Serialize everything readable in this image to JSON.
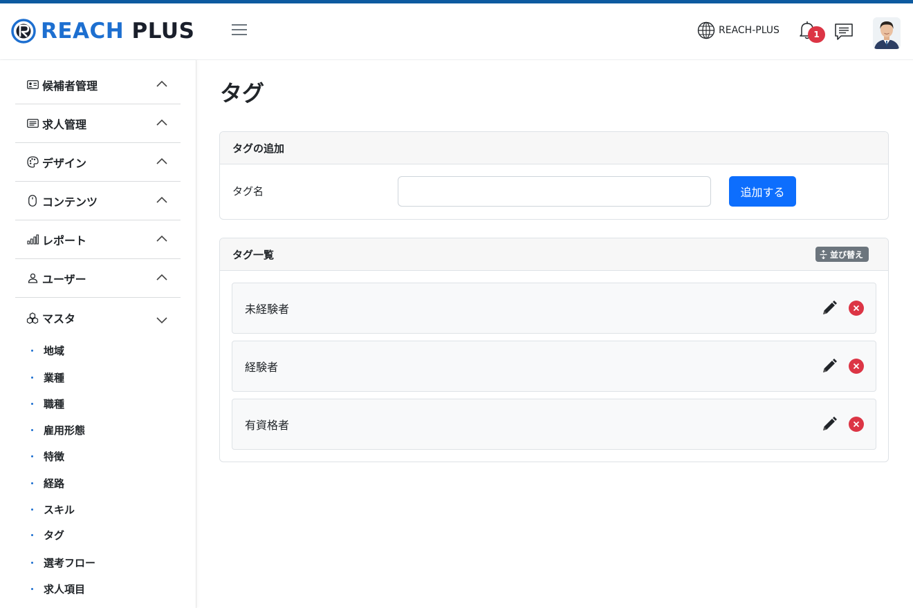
{
  "header": {
    "brand_part1": "REACH",
    "brand_part2": "PLUS",
    "org_name": "REACH-PLUS",
    "notification_count": "1",
    "brand_color": "#1d6fd0",
    "icons": [
      "logo-mark-icon",
      "hamburger-icon",
      "globe-icon",
      "bell-icon",
      "chat-icon"
    ]
  },
  "sidebar": {
    "groups": [
      {
        "label": "候補者管理",
        "icon": "id-card-icon",
        "expanded": false
      },
      {
        "label": "求人管理",
        "icon": "list-icon",
        "expanded": false
      },
      {
        "label": "デザイン",
        "icon": "palette-icon",
        "expanded": false
      },
      {
        "label": "コンテンツ",
        "icon": "mouse-icon",
        "expanded": false
      },
      {
        "label": "レポート",
        "icon": "bar-chart-icon",
        "expanded": false
      },
      {
        "label": "ユーザー",
        "icon": "person-icon",
        "expanded": false
      },
      {
        "label": "マスタ",
        "icon": "boxes-icon",
        "expanded": true
      }
    ],
    "master_items": [
      "地域",
      "業種",
      "職種",
      "雇用形態",
      "特徴",
      "経路",
      "スキル",
      "タグ",
      "選考フロー",
      "求人項目"
    ]
  },
  "main": {
    "page_title": "タグ",
    "add_card": {
      "title": "タグの追加",
      "field_label": "タグ名",
      "field_value": "",
      "submit_label": "追加する"
    },
    "list_card": {
      "title": "タグ一覧",
      "sort_label": "並び替え",
      "tags": [
        "未経験者",
        "経験者",
        "有資格者"
      ]
    }
  },
  "colors": {
    "primary": "#0d6efd",
    "danger": "#dc3545",
    "secondary": "#6c757d"
  }
}
